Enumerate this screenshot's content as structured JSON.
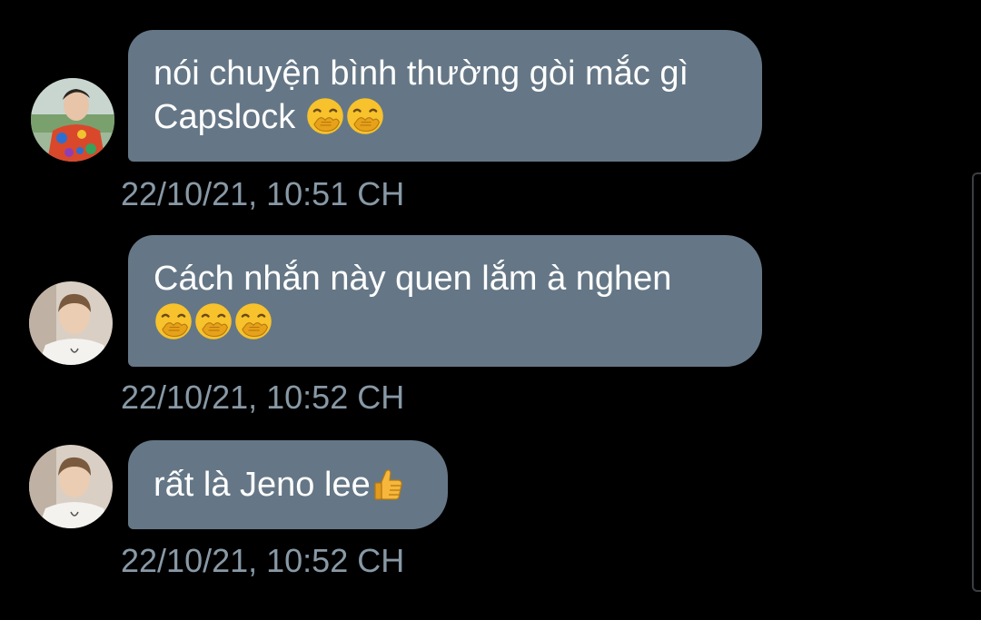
{
  "colors": {
    "background": "#000000",
    "bubble": "#657786",
    "timestamp": "#8899a6"
  },
  "messages": [
    {
      "avatar": "avatar-photo-colorful-shirt",
      "lines": [
        "nói chuyện bình thường gòi mắc gì",
        "Capslock"
      ],
      "emojis": [
        "face-with-hand-over-mouth",
        "face-with-hand-over-mouth"
      ],
      "time": "22/10/21, 10:51 CH"
    },
    {
      "avatar": "avatar-photo-white-shirt",
      "lines": [
        "Cách nhắn này quen lắm à nghen",
        ""
      ],
      "emojis": [
        "face-with-hand-over-mouth",
        "face-with-hand-over-mouth",
        "face-with-hand-over-mouth"
      ],
      "time": "22/10/21, 10:52 CH"
    },
    {
      "avatar": "avatar-photo-white-shirt",
      "lines": [
        "rất là Jeno lee"
      ],
      "emojis": [
        "thumbs-up"
      ],
      "time": "22/10/21, 10:52 CH"
    }
  ]
}
